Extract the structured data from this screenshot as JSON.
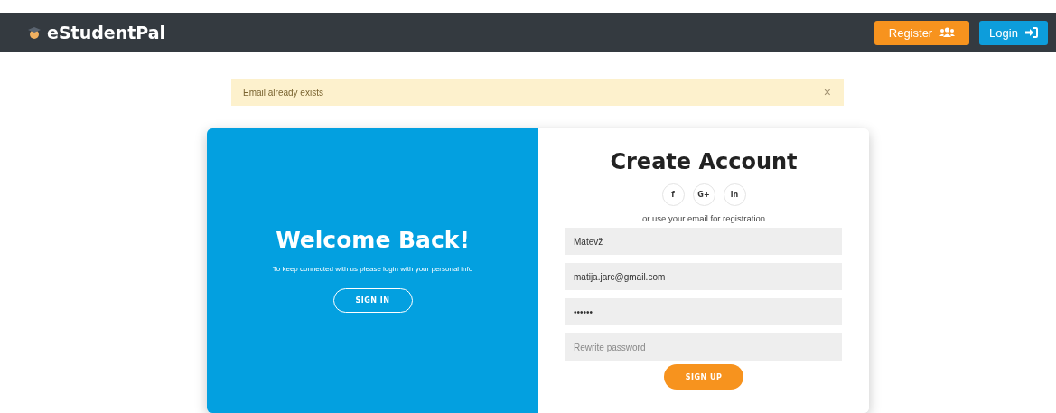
{
  "navbar": {
    "brand": "eStudentPal",
    "buttons": [
      {
        "label": "Register",
        "kind": "register"
      },
      {
        "label": "Login",
        "kind": "login"
      }
    ]
  },
  "alert": {
    "message": "Email already exists",
    "close": "×"
  },
  "welcome": {
    "title": "Welcome Back!",
    "text": "To keep connected with us please login with your personal info",
    "button": "SIGN IN"
  },
  "signup": {
    "title": "Create Account",
    "social": [
      "f",
      "G+",
      "in"
    ],
    "hint": "or use your email for registration",
    "fields": [
      {
        "value": "Matevž"
      },
      {
        "value": "matija.jarc@gmail.com"
      },
      {
        "value": "••••••"
      },
      {
        "placeholder": "Rewrite password"
      }
    ],
    "button": "SIGN UP"
  }
}
